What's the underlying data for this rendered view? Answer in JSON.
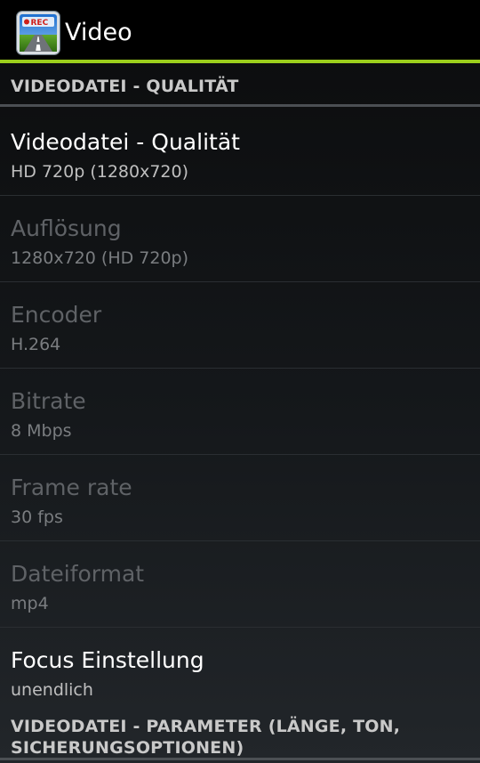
{
  "action_bar": {
    "title": "Video",
    "icon": "rec-camera-road-icon",
    "icon_badge": "REC",
    "accent_color": "#9ccf1c"
  },
  "categories": {
    "quality": "VIDEODATEI - QUALITÄT",
    "parameters": "VIDEODATEI - PARAMETER (LÄNGE, TON, SICHERUNGSOPTIONEN)"
  },
  "preferences": [
    {
      "title": "Videodatei - Qualität",
      "summary": "HD 720p (1280x720)",
      "enabled": true
    },
    {
      "title": "Auflösung",
      "summary": "1280x720 (HD 720p)",
      "enabled": false
    },
    {
      "title": "Encoder",
      "summary": "H.264",
      "enabled": false
    },
    {
      "title": "Bitrate",
      "summary": "8 Mbps",
      "enabled": false
    },
    {
      "title": "Frame rate",
      "summary": "30 fps",
      "enabled": false
    },
    {
      "title": "Dateiformat",
      "summary": "mp4",
      "enabled": false
    },
    {
      "title": "Focus Einstellung",
      "summary": "unendlich",
      "enabled": true
    }
  ]
}
